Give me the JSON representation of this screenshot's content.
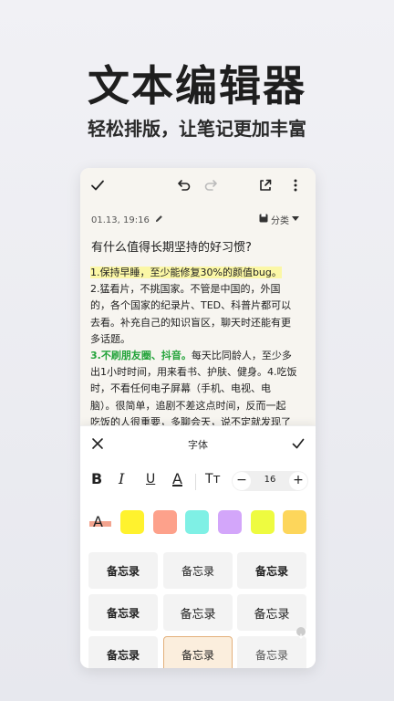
{
  "hero": {
    "title": "文本编辑器",
    "subtitle": "轻松排版，让笔记更加丰富"
  },
  "toolbar": {
    "icons": [
      "check-icon",
      "undo-icon",
      "redo-icon",
      "share-icon",
      "more-icon"
    ]
  },
  "note": {
    "date": "01.13, 19:16",
    "category": "分类",
    "title": "有什么值得长期坚持的好习惯?",
    "lines": [
      "1.保持早睡，至少能修复30%的颜值bug。",
      "2.猛看片，不挑国家。不管是中国的，外国",
      "的，各个国家的纪录片、TED、科普片都可以",
      "去看。补充自己的知识盲区，聊天时还能有更",
      "多话题。",
      "3.不刷朋友圈、抖音。",
      "每天比同龄人，至少多",
      "出1小时时间，用来看书、护肤、健身。4.吃饭",
      "时，不看任何电子屏幕（手机、电视、电",
      "脑）。很简单，追剧不差这点时间，反而一起",
      "吃饭的人很重要，多聊会天，说不定就发现了"
    ]
  },
  "panel": {
    "title": "字体",
    "format_buttons": [
      "B",
      "I",
      "U",
      "A",
      "Tт"
    ],
    "font_size": "16",
    "minus": "−",
    "plus": "+",
    "swatch_colors": [
      "#fff22e",
      "#fda18b",
      "#7ff0e5",
      "#d3a6fa",
      "#eefb40",
      "#fdd65b"
    ],
    "text_color_label": "A",
    "fonts": [
      "备忘录",
      "备忘录",
      "备忘录",
      "备忘录",
      "备忘录",
      "备忘录",
      "备忘录",
      "备忘录",
      "备忘录"
    ]
  }
}
